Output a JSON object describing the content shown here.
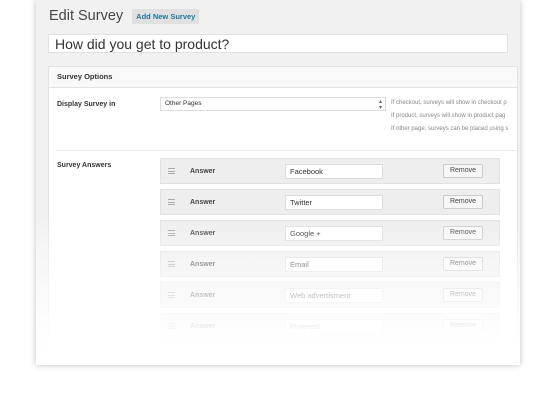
{
  "header": {
    "title": "Edit Survey",
    "add_new_label": "Add New Survey"
  },
  "survey": {
    "question": "How did you get to product?"
  },
  "options": {
    "heading": "Survey Options",
    "display_label": "Display Survey in",
    "display_value": "Other Pages",
    "hints": [
      "If checkout, surveys will show in checkout p",
      "If product, surveys will show in product pag",
      "If other page, surveys can be placed using s"
    ],
    "answers_label": "Survey Answers"
  },
  "answers": [
    {
      "label": "Answer",
      "value": "Facebook",
      "remove": "Remove"
    },
    {
      "label": "Answer",
      "value": "Twitter",
      "remove": "Remove"
    },
    {
      "label": "Answer",
      "value": "Google +",
      "remove": "Remove"
    },
    {
      "label": "Answer",
      "value": "Email",
      "remove": "Remove"
    },
    {
      "label": "Answer",
      "value": "Web advertisment",
      "remove": "Remove"
    },
    {
      "label": "Answer",
      "value": "Pinterest",
      "remove": "Remove"
    }
  ]
}
